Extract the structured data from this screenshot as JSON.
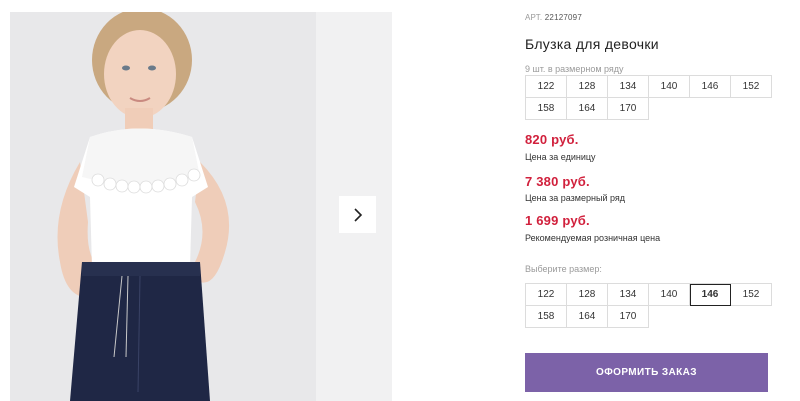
{
  "gallery": {
    "next_icon": "chevron-right-icon"
  },
  "product": {
    "article_label": "АРТ.",
    "article_number": "22127097",
    "title": "Блузка для девочки",
    "line_note": "9 шт. в размерном ряду",
    "line_sizes": [
      "122",
      "128",
      "134",
      "140",
      "146",
      "152",
      "158",
      "164",
      "170"
    ],
    "prices": [
      {
        "value": "820 руб.",
        "caption": "Цена за единицу"
      },
      {
        "value": "7 380 руб.",
        "caption": "Цена за размерный ряд"
      },
      {
        "value": "1 699 руб.",
        "caption": "Рекомендуемая розничная цена"
      }
    ],
    "choose_size_label": "Выберите размер:",
    "size_options": [
      "122",
      "128",
      "134",
      "140",
      "146",
      "152",
      "158",
      "164",
      "170"
    ],
    "selected_size": "146",
    "order_button": "ОФОРМИТЬ ЗАКАЗ"
  },
  "colors": {
    "price": "#d1203c",
    "button": "#7c62a8"
  }
}
